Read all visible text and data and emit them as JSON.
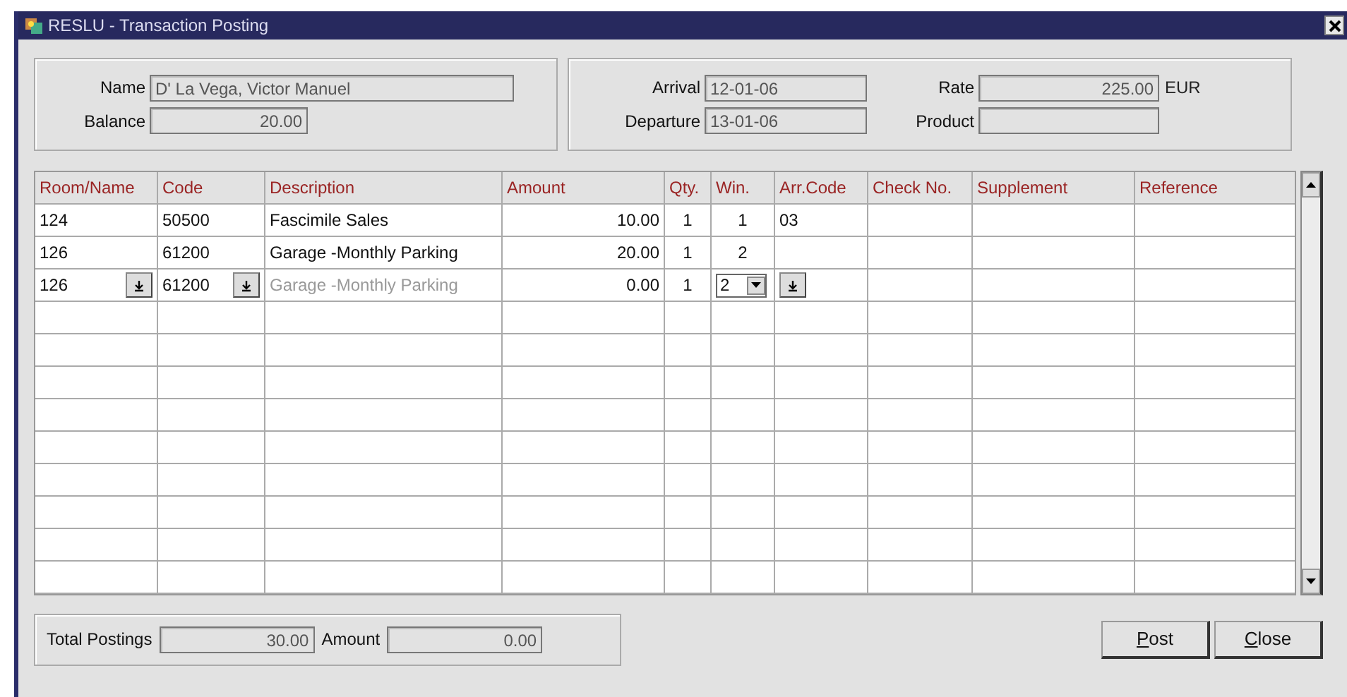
{
  "window": {
    "title": "RESLU - Transaction Posting"
  },
  "guest": {
    "name_label": "Name",
    "name": "D' La Vega, Victor Manuel",
    "balance_label": "Balance",
    "balance": "20.00"
  },
  "stay": {
    "arrival_label": "Arrival",
    "arrival": "12-01-06",
    "departure_label": "Departure",
    "departure": "13-01-06",
    "rate_label": "Rate",
    "rate": "225.00",
    "currency": "EUR",
    "product_label": "Product"
  },
  "table": {
    "columns": [
      {
        "label": "Room/Name",
        "kind": "lookup"
      },
      {
        "label": "Code",
        "kind": "lookup"
      },
      {
        "label": "Description",
        "kind": "text"
      },
      {
        "label": "Amount",
        "kind": "text"
      },
      {
        "label": "Qty.",
        "kind": "text"
      },
      {
        "label": "Win.",
        "kind": "select"
      },
      {
        "label": "Arr.Code",
        "kind": "lookup"
      },
      {
        "label": "Check No.",
        "kind": "text"
      },
      {
        "label": "Supplement",
        "kind": "text"
      },
      {
        "label": "Reference",
        "kind": "text"
      }
    ],
    "rows": [
      {
        "editing": false,
        "cells": [
          "124",
          "50500",
          "Fascimile Sales",
          "10.00",
          "1",
          "1",
          "03"
        ]
      },
      {
        "editing": false,
        "cells": [
          "126",
          "61200",
          "Garage -Monthly Parking",
          "20.00",
          "1",
          "2"
        ]
      },
      {
        "editing": true,
        "cells": [
          "126",
          "61200",
          "Garage -Monthly Parking",
          "0.00",
          "1",
          "2"
        ]
      }
    ]
  },
  "totals": {
    "total_label": "Total Postings",
    "total": "30.00",
    "amount_label": "Amount",
    "amount": "0.00"
  },
  "buttons": [
    {
      "label": "Post"
    },
    {
      "label": "Close"
    }
  ]
}
